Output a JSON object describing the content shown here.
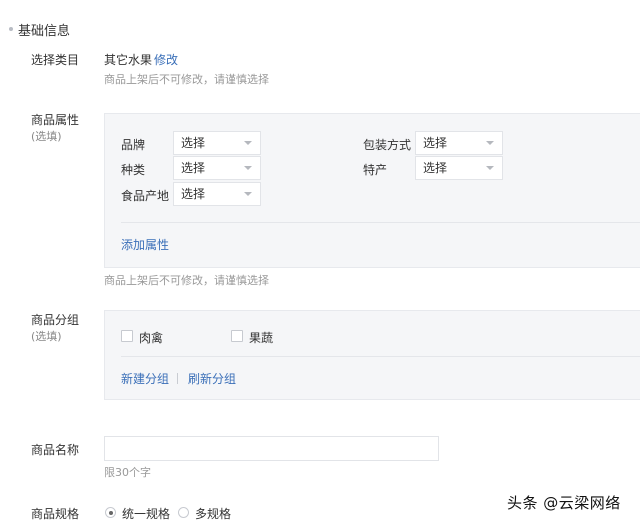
{
  "section": {
    "title": "基础信息"
  },
  "category": {
    "label": "选择类目",
    "value": "其它水果",
    "edit_link": "修改",
    "hint": "商品上架后不可修改，请谨慎选择"
  },
  "attributes": {
    "label": "商品属性",
    "optional": "(选填)",
    "fields": [
      {
        "label": "品牌",
        "select": "选择"
      },
      {
        "label": "包装方式",
        "select": "选择"
      },
      {
        "label": "种类",
        "select": "选择"
      },
      {
        "label": "特产",
        "select": "选择"
      },
      {
        "label": "食品产地",
        "select": "选择"
      }
    ],
    "add_link": "添加属性",
    "hint": "商品上架后不可修改，请谨慎选择"
  },
  "groups": {
    "label": "商品分组",
    "optional": "(选填)",
    "options": [
      {
        "label": "肉禽",
        "checked": false
      },
      {
        "label": "果蔬",
        "checked": false
      }
    ],
    "new_link": "新建分组",
    "refresh_link": "刷新分组"
  },
  "name": {
    "label": "商品名称",
    "value": "",
    "hint": "限30个字"
  },
  "spec": {
    "label": "商品规格",
    "options": [
      {
        "label": "统一规格",
        "checked": true
      },
      {
        "label": "多规格",
        "checked": false
      }
    ]
  },
  "watermark": "头条 @云梁网络"
}
